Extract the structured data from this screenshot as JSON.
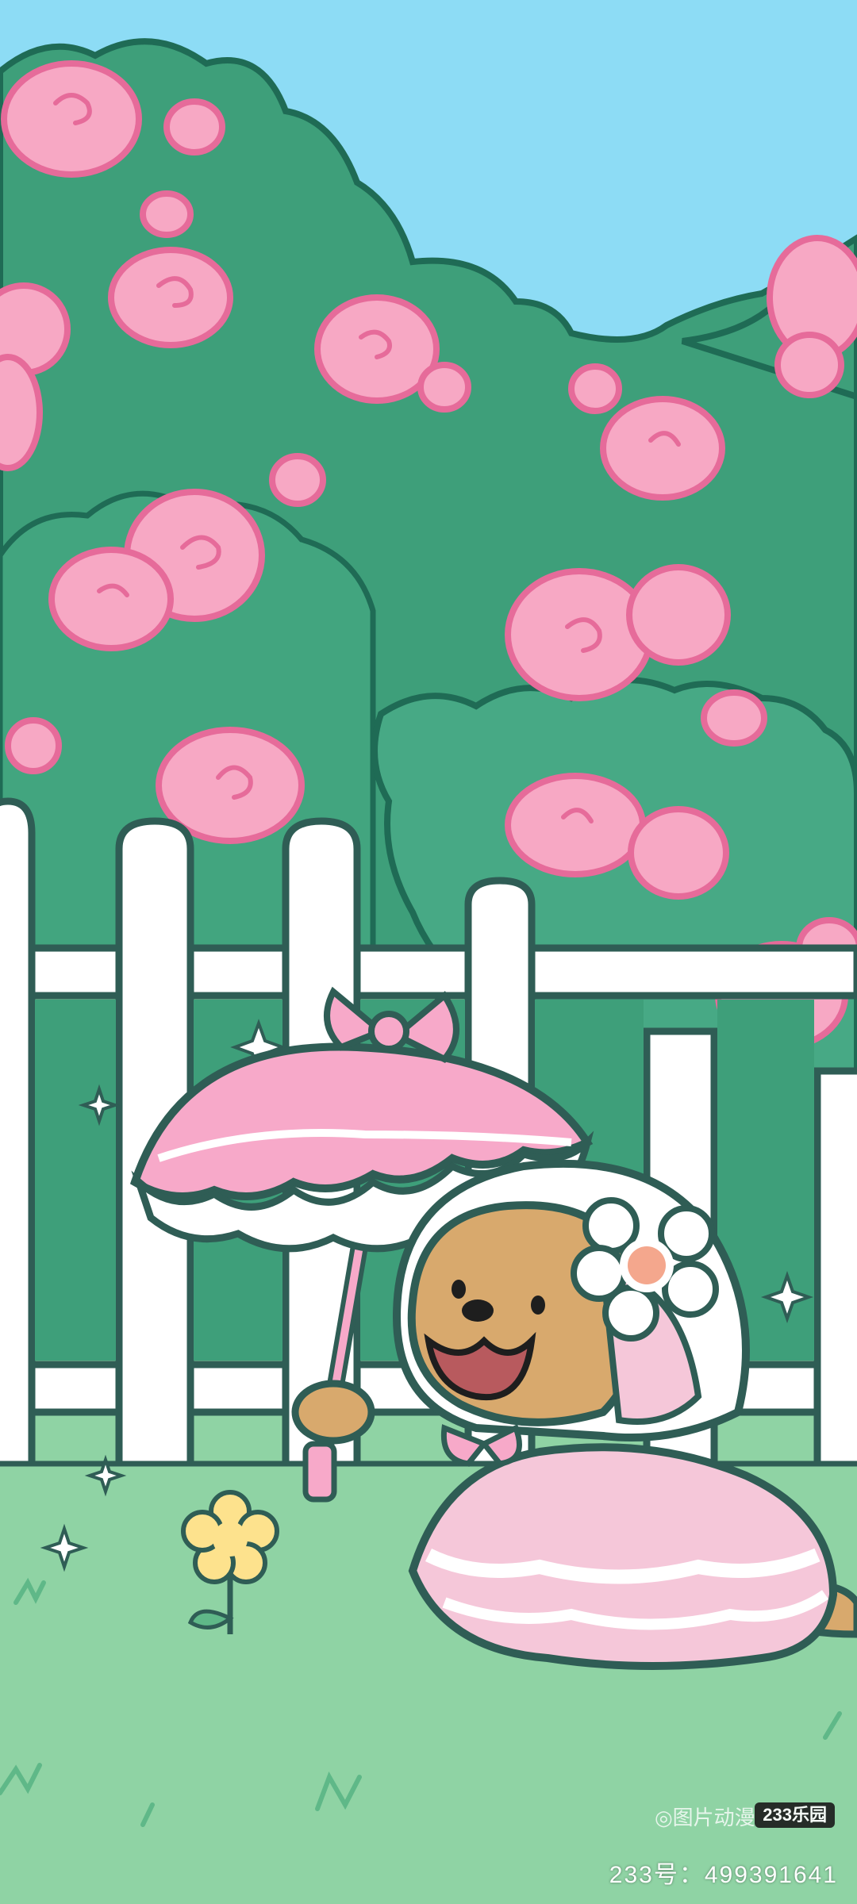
{
  "watermark": {
    "brand_badge": "233乐园",
    "account_line": "233号：499391641",
    "faint_text": "◎图片动漫"
  },
  "colors": {
    "sky": "#8ddcf5",
    "bush": "#3e9f7a",
    "bush_outline": "#1f6b55",
    "rose_pink": "#f7a8c4",
    "rose_outline": "#e66b9a",
    "fence": "#ffffff",
    "fence_outline": "#2f5d55",
    "grass": "#8fd3a4",
    "dog_fur": "#d8a96d",
    "umbrella_pink": "#f7a9c9",
    "flower_yellow": "#fde28d"
  }
}
